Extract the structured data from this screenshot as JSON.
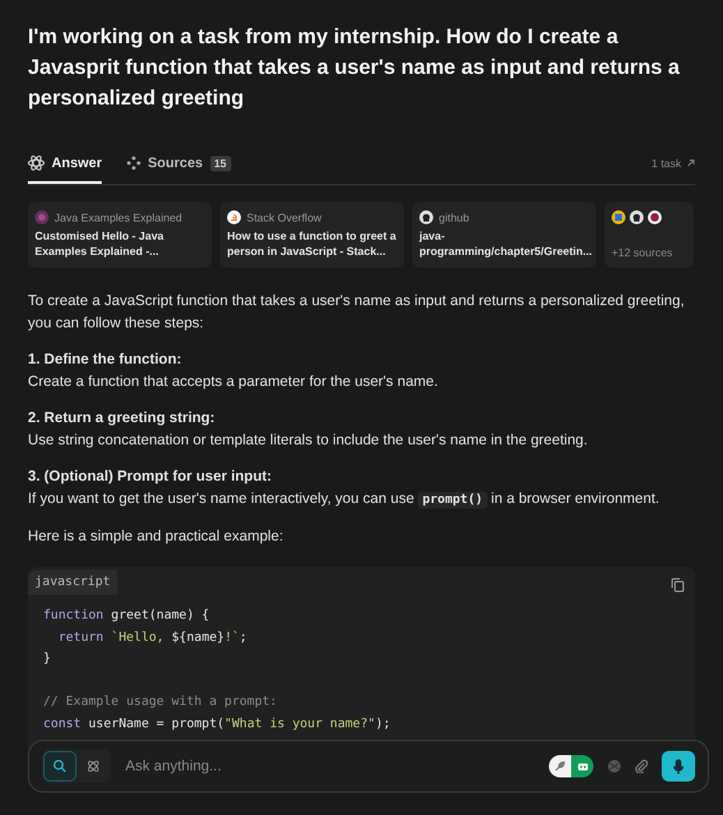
{
  "question": "I'm working on a task from my internship. How do I create a Javasprit function that takes a user's name as input and returns a personalized greeting",
  "tabs": [
    {
      "label": "Answer",
      "kind": "answer",
      "selected": true
    },
    {
      "label": "Sources",
      "kind": "sources",
      "badge": "15",
      "selected": false
    }
  ],
  "task_link": "1 task",
  "sources": [
    {
      "site": "Java Examples Explained",
      "kind": "gem",
      "title": "Customised Hello - Java Examples Explained -..."
    },
    {
      "site": "Stack Overflow",
      "kind": "stack",
      "title": "How to use a function to greet a person in JavaScript - Stack..."
    },
    {
      "site": "github",
      "kind": "github",
      "title": "java-programming/chapter5/Greetin..."
    }
  ],
  "more_sources": {
    "label": "+12 sources"
  },
  "intro": "To create a JavaScript function that takes a user's name as input and returns a personalized greeting, you can follow these steps:",
  "steps": [
    {
      "heading": "1. Define the function:",
      "body": [
        {
          "kind": "text",
          "text": "Create a function that accepts a parameter for the user's name."
        }
      ]
    },
    {
      "heading": "2. Return a greeting string:",
      "body": [
        {
          "kind": "text",
          "text": "Use string concatenation or template literals to include the user's name in the greeting."
        }
      ]
    },
    {
      "heading": "3. (Optional) Prompt for user input:",
      "body": [
        {
          "kind": "text",
          "text": "If you want to get the user's name interactively, you can use "
        },
        {
          "kind": "code",
          "text": "prompt()"
        },
        {
          "kind": "text",
          "text": " in a browser environment."
        }
      ]
    }
  ],
  "example_intro": "Here is a simple and practical example:",
  "code": {
    "language": "javascript",
    "lines": [
      {
        "kind": "code",
        "tokens": [
          {
            "kind": "keyword",
            "text": "function "
          },
          {
            "kind": "plain",
            "text": "greet(name) {"
          }
        ]
      },
      {
        "kind": "code",
        "tokens": [
          {
            "kind": "keyword",
            "text": "  return "
          },
          {
            "kind": "string",
            "text": "`Hello, "
          },
          {
            "kind": "plain",
            "text": "${name}"
          },
          {
            "kind": "string",
            "text": "!`"
          },
          {
            "kind": "plain",
            "text": ";"
          }
        ]
      },
      {
        "kind": "code",
        "tokens": [
          {
            "kind": "plain",
            "text": "}"
          }
        ]
      },
      {
        "kind": "blank"
      },
      {
        "kind": "code",
        "tokens": [
          {
            "kind": "comment",
            "text": "// Example usage with a prompt:"
          }
        ]
      },
      {
        "kind": "code",
        "tokens": [
          {
            "kind": "keyword",
            "text": "const "
          },
          {
            "kind": "plain",
            "text": "userName = prompt("
          },
          {
            "kind": "string",
            "text": "\"What is your name?\""
          },
          {
            "kind": "plain",
            "text": ");"
          }
        ]
      }
    ]
  },
  "input": {
    "placeholder": "Ask anything..."
  }
}
